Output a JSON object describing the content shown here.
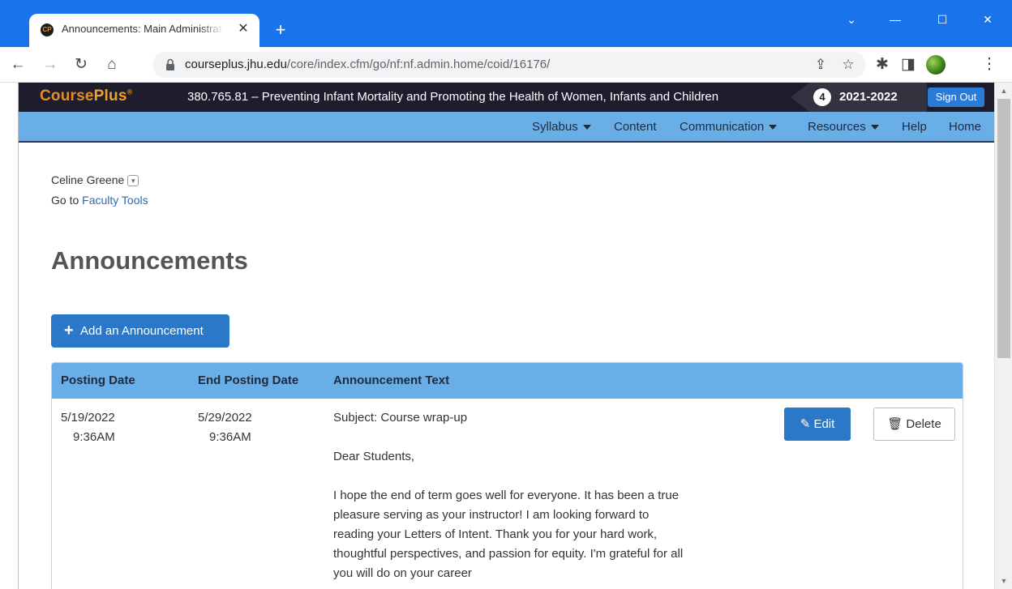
{
  "browser": {
    "tab_title": "Announcements: Main Administrat",
    "favicon_text": "CP",
    "url_host": "courseplus.jhu.edu",
    "url_path": "/core/index.cfm/go/nf:nf.admin.home/coid/16176/"
  },
  "site": {
    "logo_a": "Course",
    "logo_b": "Plus",
    "logo_reg": "®",
    "course_title": "380.765.81 – Preventing Infant Mortality and Promoting the Health of Women, Infants and Children",
    "term_number": "4",
    "term_year": "2021-2022",
    "sign_out": "Sign Out"
  },
  "nav": {
    "syllabus": "Syllabus",
    "content": "Content",
    "communication": "Communication",
    "resources": "Resources",
    "help": "Help",
    "home": "Home"
  },
  "page": {
    "user_name": "Celine Greene",
    "goto_prefix": "Go to",
    "goto_link": "Faculty Tools",
    "heading": "Announcements",
    "add_button": "Add an Announcement"
  },
  "table": {
    "headers": {
      "posting_date": "Posting Date",
      "end_posting_date": "End Posting Date",
      "text": "Announcement Text"
    },
    "rows": [
      {
        "posting_date": "5/19/2022",
        "posting_time": "9:36AM",
        "end_date": "5/29/2022",
        "end_time": "9:36AM",
        "subject": "Subject: Course wrap-up",
        "greeting": "Dear Students,",
        "body": "I hope the end of term goes well for everyone. It has been a true pleasure serving as your instructor! I am looking forward to reading your Letters of Intent. Thank you for your hard work, thoughtful perspectives, and passion for equity. I'm grateful for all you will do on your career",
        "edit": "Edit",
        "delete": "Delete"
      }
    ]
  }
}
